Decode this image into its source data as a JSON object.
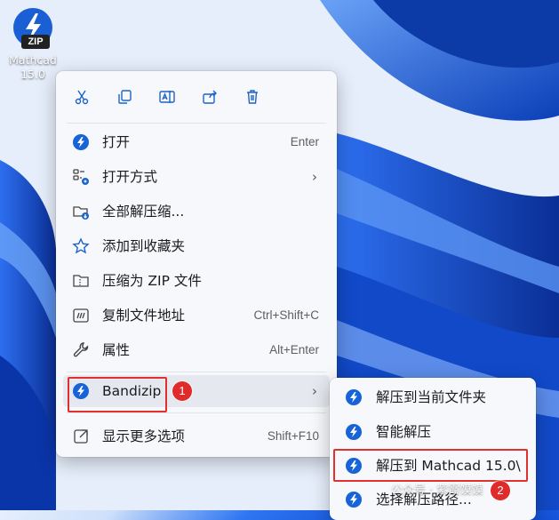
{
  "desktop": {
    "icon_label_line1": "Mathcad",
    "icon_label_line2": "15.0",
    "zip_text": "ZIP"
  },
  "toolbar": {
    "cut_icon": "scissors-icon",
    "copy_icon": "copy-icon",
    "rename_icon": "rename-icon",
    "share_icon": "share-icon",
    "delete_icon": "trash-icon"
  },
  "menu": {
    "items": [
      {
        "label": "打开",
        "shortcut": "Enter",
        "icon": "bandizip-icon"
      },
      {
        "label": "打开方式",
        "shortcut": "",
        "icon": "open-with-icon"
      },
      {
        "label": "全部解压缩...",
        "shortcut": "",
        "icon": "extract-all-icon"
      },
      {
        "label": "添加到收藏夹",
        "shortcut": "",
        "icon": "star-icon"
      },
      {
        "label": "压缩为 ZIP 文件",
        "shortcut": "",
        "icon": "zip-folder-icon"
      },
      {
        "label": "复制文件地址",
        "shortcut": "Ctrl+Shift+C",
        "icon": "copy-path-icon"
      },
      {
        "label": "属性",
        "shortcut": "Alt+Enter",
        "icon": "wrench-icon"
      },
      {
        "label": "Bandizip",
        "shortcut": "",
        "icon": "bandizip-icon"
      },
      {
        "label": "显示更多选项",
        "shortcut": "Shift+F10",
        "icon": "more-options-icon"
      }
    ]
  },
  "submenu": {
    "items": [
      {
        "label": "解压到当前文件夹"
      },
      {
        "label": "智能解压"
      },
      {
        "label": "解压到 Mathcad 15.0\\"
      },
      {
        "label": "选择解压路径..."
      }
    ]
  },
  "annotations": {
    "badge1": "1",
    "badge2": "2",
    "color": "#e0312e"
  },
  "watermark": "公众号 · 紫霞馍馍"
}
